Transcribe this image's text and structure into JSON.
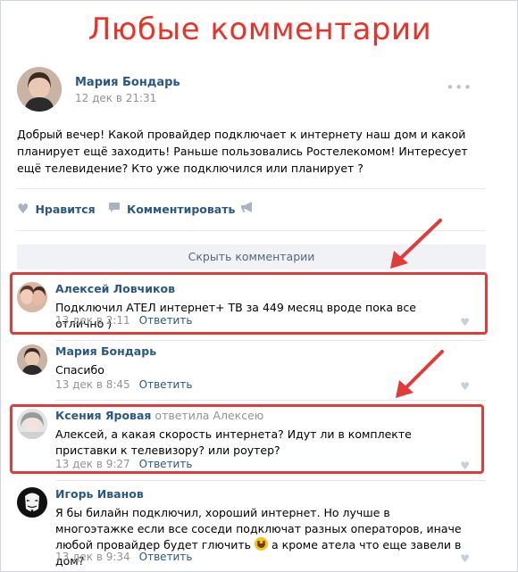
{
  "banner_title": "Любые комментарии",
  "post": {
    "author": "Мария Бондарь",
    "date": "12 дек в 21:31",
    "text": "Добрый вечер! Какой провайдер подключает к интернету наш дом и какой планирует ещё заходить! Раньше пользовались Ростелекомом! Интересует ещё телевидение? Кто уже подключился или планирует ?",
    "more_icon": "•••",
    "actions": {
      "like_label": "Нравится",
      "comment_label": "Комментировать",
      "like_icon": "heart-icon",
      "comment_icon": "speech-bubble-icon",
      "share_icon": "megaphone-icon"
    }
  },
  "hide_comments_label": "Скрыть комментарии",
  "comments": [
    {
      "author": "Алексей Ловчиков",
      "reply_to": "",
      "text": "Подключил АТЕЛ интернет+ ТВ за 449 месяц вроде пока все отлично )",
      "date": "13 дек в 2:11",
      "reply_label": "Ответить"
    },
    {
      "author": "Мария Бондарь",
      "reply_to": "",
      "text": "Спасибо",
      "date": "13 дек в 8:45",
      "reply_label": "Ответить"
    },
    {
      "author": "Ксения Яровая",
      "reply_to": "ответила Алексею",
      "text": "Алексей, а какая скорость интернета? Идут ли в комплекте приставки к телевизору? или роутер?",
      "date": "13 дек в 9:27",
      "reply_label": "Ответить"
    },
    {
      "author": "Игорь Иванов",
      "reply_to": "",
      "text_before_emoji": "Я бы билайн подключил, хороший интернет. Но лучше в многоэтажке если все соседи подключат разных операторов, иначе любой провайдер будет глючить",
      "text_after_emoji": " а кроме атела что еще завели в дом?",
      "date": "13 дек в 9:34",
      "reply_label": "Ответить"
    }
  ],
  "colors": {
    "link": "#2a5885",
    "meta": "#939393",
    "highlight": "#e23b3b",
    "banner": "#e8322a"
  }
}
